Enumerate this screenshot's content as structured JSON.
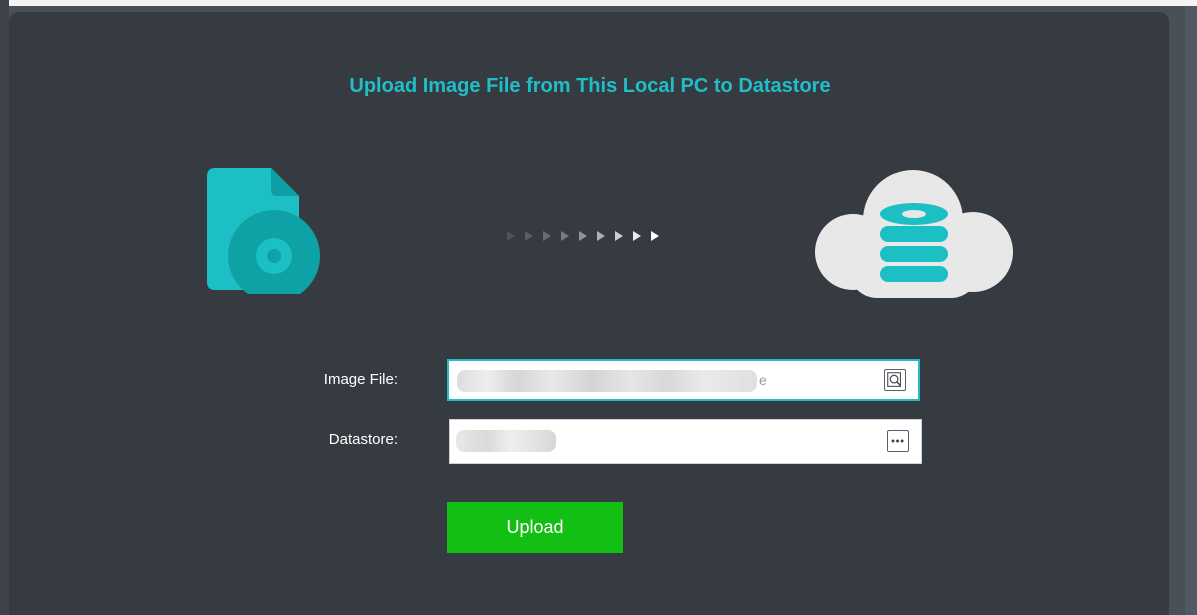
{
  "dialog": {
    "title": "Upload Image File from This Local PC to Datastore"
  },
  "icons": {
    "source": "disc-image-file-icon",
    "transfer": "transfer-arrows-icon",
    "destination": "cloud-datastore-icon",
    "browse": "browse-search-icon",
    "more": "more-options-icon"
  },
  "form": {
    "image_file": {
      "label": "Image File:",
      "value": "",
      "trailing_visible": "e"
    },
    "datastore": {
      "label": "Datastore:",
      "value": ""
    },
    "upload_label": "Upload"
  },
  "colors": {
    "panel_bg": "#363b42",
    "accent": "#1fbec8",
    "upload_button": "#13bf13",
    "cloud": "#e8e8e8"
  }
}
